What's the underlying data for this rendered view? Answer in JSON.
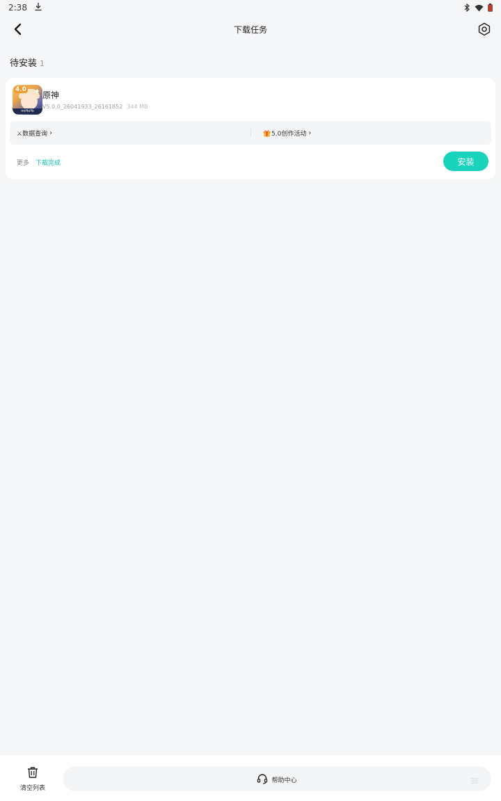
{
  "status_bar": {
    "time": "2:38",
    "icons": [
      "download-icon",
      "bluetooth-icon",
      "wifi-icon",
      "battery-icon"
    ]
  },
  "header": {
    "title": "下载任务",
    "back_icon": "chevron-left-icon",
    "settings_icon": "settings-icon"
  },
  "section": {
    "title": "待安装",
    "count": "1"
  },
  "task": {
    "app_name": "原神",
    "version": "V5.0.0_26041933_26161852",
    "size": "344 MB",
    "icon_badge": "4.0",
    "icon_brand": "miHoYo",
    "link_left": "⚔数据查询",
    "link_right": "5.0创作活动",
    "more_label": "更多",
    "status": "下载完成",
    "install_label": "安装"
  },
  "bottom_bar": {
    "clear_label": "清空列表",
    "help_label": "帮助中心"
  },
  "colors": {
    "accent": "#19d3bc",
    "status_text": "#10c2b0",
    "background": "#f5f6f8"
  }
}
